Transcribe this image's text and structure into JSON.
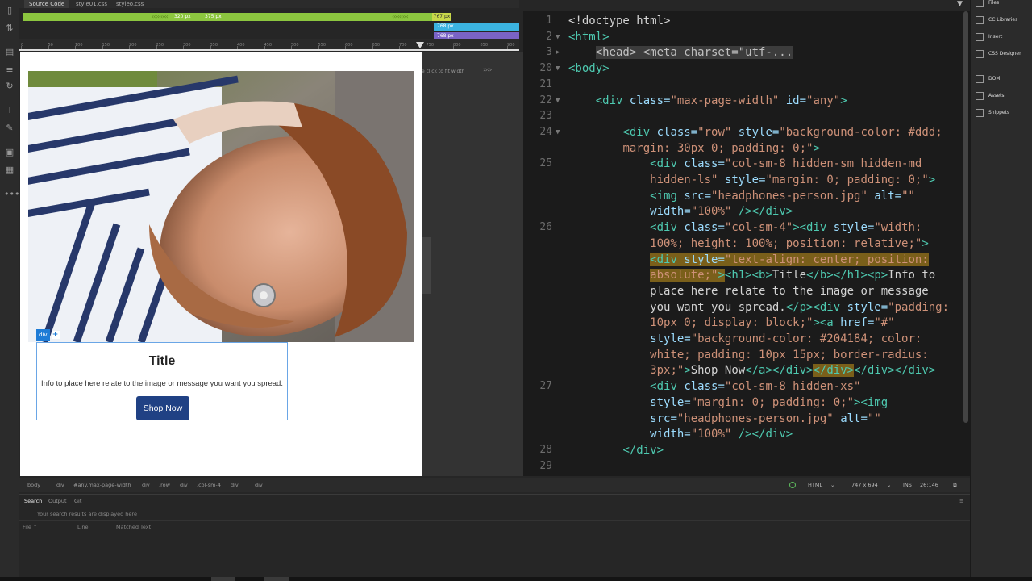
{
  "doc_tabs": [
    "Source Code",
    "style01.css",
    "styleo.css"
  ],
  "media_queries": {
    "green_label_a": "320 px",
    "green_label_b": "375 px",
    "yellow_label": "767 px",
    "cyan_label": "768 px",
    "purple_label": "768 px"
  },
  "ruler_ticks": [
    "0",
    "50",
    "100",
    "150",
    "200",
    "250",
    "300",
    "350",
    "400",
    "450",
    "500",
    "550",
    "600",
    "650",
    "700",
    "750",
    "800",
    "850",
    "900"
  ],
  "fit_hint": "e click to fit width",
  "design": {
    "div_tag": "div",
    "div_plus": "+",
    "card_title": "Title",
    "card_info": "Info to place here relate to the image or message you want you spread.",
    "shop_button": "Shop Now",
    "button_color": "#204184"
  },
  "code_lines": [
    {
      "num": "1",
      "fold": "",
      "html": "<span class=\"tx\">&lt;!doctype html&gt;</span>"
    },
    {
      "num": "2",
      "fold": "▼",
      "html": "<span class=\"tg\">&lt;html&gt;</span>"
    },
    {
      "num": "3",
      "fold": "▶",
      "html": "    <span class=\"hl-grey\">&lt;head&gt; &lt;meta charset=\"utf-...</span>"
    },
    {
      "num": "20",
      "fold": "▼",
      "html": "<span class=\"tg\">&lt;body&gt;</span>"
    },
    {
      "num": "21",
      "fold": "",
      "html": ""
    },
    {
      "num": "22",
      "fold": "▼",
      "html": "    <span class=\"tg\">&lt;div </span><span class=\"at\">class=</span><span class=\"st\">\"max-page-width\"</span> <span class=\"at\">id=</span><span class=\"st\">\"any\"</span><span class=\"tg\">&gt;</span>"
    },
    {
      "num": "23",
      "fold": "",
      "html": ""
    },
    {
      "num": "24",
      "fold": "▼",
      "html": "        <span class=\"tg\">&lt;div </span><span class=\"at\">class=</span><span class=\"st\">\"row\"</span> <span class=\"at\">style=</span><span class=\"st\">\"background-color: #ddd;</span>"
    },
    {
      "num": "",
      "fold": "",
      "html": "        <span class=\"st\">margin: 30px 0; padding: 0;\"</span><span class=\"tg\">&gt;</span>"
    },
    {
      "num": "25",
      "fold": "",
      "html": "            <span class=\"tg\">&lt;div </span><span class=\"at\">class=</span><span class=\"st\">\"col-sm-8 hidden-sm hidden-md</span>"
    },
    {
      "num": "",
      "fold": "",
      "html": "            <span class=\"st\">hidden-ls\"</span> <span class=\"at\">style=</span><span class=\"st\">\"margin: 0; padding: 0;\"</span><span class=\"tg\">&gt;</span>"
    },
    {
      "num": "",
      "fold": "",
      "html": "            <span class=\"tg\">&lt;img </span><span class=\"at\">src=</span><span class=\"st\">\"headphones-person.jpg\"</span> <span class=\"at\">alt=</span><span class=\"st\">\"\"</span>"
    },
    {
      "num": "",
      "fold": "",
      "html": "            <span class=\"at\">width=</span><span class=\"st\">\"100%\"</span> <span class=\"tg\">/&gt;&lt;/div&gt;</span>"
    },
    {
      "num": "26",
      "fold": "",
      "html": "            <span class=\"tg\">&lt;div </span><span class=\"at\">class=</span><span class=\"st\">\"col-sm-4\"</span><span class=\"tg\">&gt;&lt;div </span><span class=\"at\">style=</span><span class=\"st\">\"width:</span>"
    },
    {
      "num": "",
      "fold": "",
      "html": "            <span class=\"st\">100%; height: 100%; position: relative;\"</span><span class=\"tg\">&gt;</span>"
    },
    {
      "num": "",
      "fold": "",
      "html": "            <span class=\"hl-gold\"><span class=\"tg\">&lt;div </span><span class=\"at\">style=</span><span class=\"st\">\"text-align: center; position:</span></span>"
    },
    {
      "num": "",
      "fold": "",
      "html": "            <span class=\"hl-gold\"><span class=\"st\">absolute;\"</span><span class=\"tg\">&gt;</span></span><span class=\"tg\">&lt;h1&gt;&lt;b&gt;</span><span class=\"tx\">Title</span><span class=\"tg\">&lt;/b&gt;&lt;/h1&gt;&lt;p&gt;</span><span class=\"tx\">Info to</span>"
    },
    {
      "num": "",
      "fold": "",
      "html": "            <span class=\"tx\">place here relate to the image or message</span>"
    },
    {
      "num": "",
      "fold": "",
      "html": "            <span class=\"tx\">you want you spread.</span><span class=\"tg\">&lt;/p&gt;&lt;div </span><span class=\"at\">style=</span><span class=\"st\">\"padding:</span>"
    },
    {
      "num": "",
      "fold": "",
      "html": "            <span class=\"st\">10px 0; display: block;\"</span><span class=\"tg\">&gt;&lt;a </span><span class=\"at\">href=</span><span class=\"st\">\"#\"</span>"
    },
    {
      "num": "",
      "fold": "",
      "html": "            <span class=\"at\">style=</span><span class=\"st\">\"background-color: #204184; color:</span>"
    },
    {
      "num": "",
      "fold": "",
      "html": "            <span class=\"st\">white; padding: 10px 15px; border-radius:</span>"
    },
    {
      "num": "",
      "fold": "",
      "html": "            <span class=\"st\">3px;\"</span><span class=\"tg\">&gt;</span><span class=\"tx\">Shop Now</span><span class=\"tg\">&lt;/a&gt;&lt;/div&gt;</span><span class=\"hl-gold\"><span class=\"tg\">&lt;/div&gt;</span></span><span class=\"tg\">&lt;/div&gt;&lt;/div&gt;</span>"
    },
    {
      "num": "27",
      "fold": "",
      "html": "            <span class=\"tg\">&lt;div </span><span class=\"at\">class=</span><span class=\"st\">\"col-sm-8 hidden-xs\"</span>"
    },
    {
      "num": "",
      "fold": "",
      "html": "            <span class=\"at\">style=</span><span class=\"st\">\"margin: 0; padding: 0;\"</span><span class=\"tg\">&gt;&lt;img</span>"
    },
    {
      "num": "",
      "fold": "",
      "html": "            <span class=\"at\">src=</span><span class=\"st\">\"headphones-person.jpg\"</span> <span class=\"at\">alt=</span><span class=\"st\">\"\"</span>"
    },
    {
      "num": "",
      "fold": "",
      "html": "            <span class=\"at\">width=</span><span class=\"st\">\"100%\"</span> <span class=\"tg\">/&gt;&lt;/div&gt;</span>"
    },
    {
      "num": "28",
      "fold": "",
      "html": "        <span class=\"tg\">&lt;/div&gt;</span>"
    },
    {
      "num": "29",
      "fold": "",
      "html": ""
    }
  ],
  "right_panel": [
    "Files",
    "CC Libraries",
    "Insert",
    "CSS Designer",
    "DOM",
    "Assets",
    "Snippets"
  ],
  "tag_selector": [
    "body",
    "div",
    "#any.max-page-width",
    "div",
    ".row",
    "div",
    ".col-sm-4",
    "div",
    "div"
  ],
  "status": {
    "language": "HTML",
    "size": "747 x 694",
    "mode": "INS",
    "position": "26:146"
  },
  "search_panel": {
    "tabs": [
      "Search",
      "Output",
      "Git"
    ],
    "placeholder": "Your search results are displayed here",
    "col_file": "File ⇡",
    "col_line": "Line",
    "col_matched": "Matched Text"
  }
}
